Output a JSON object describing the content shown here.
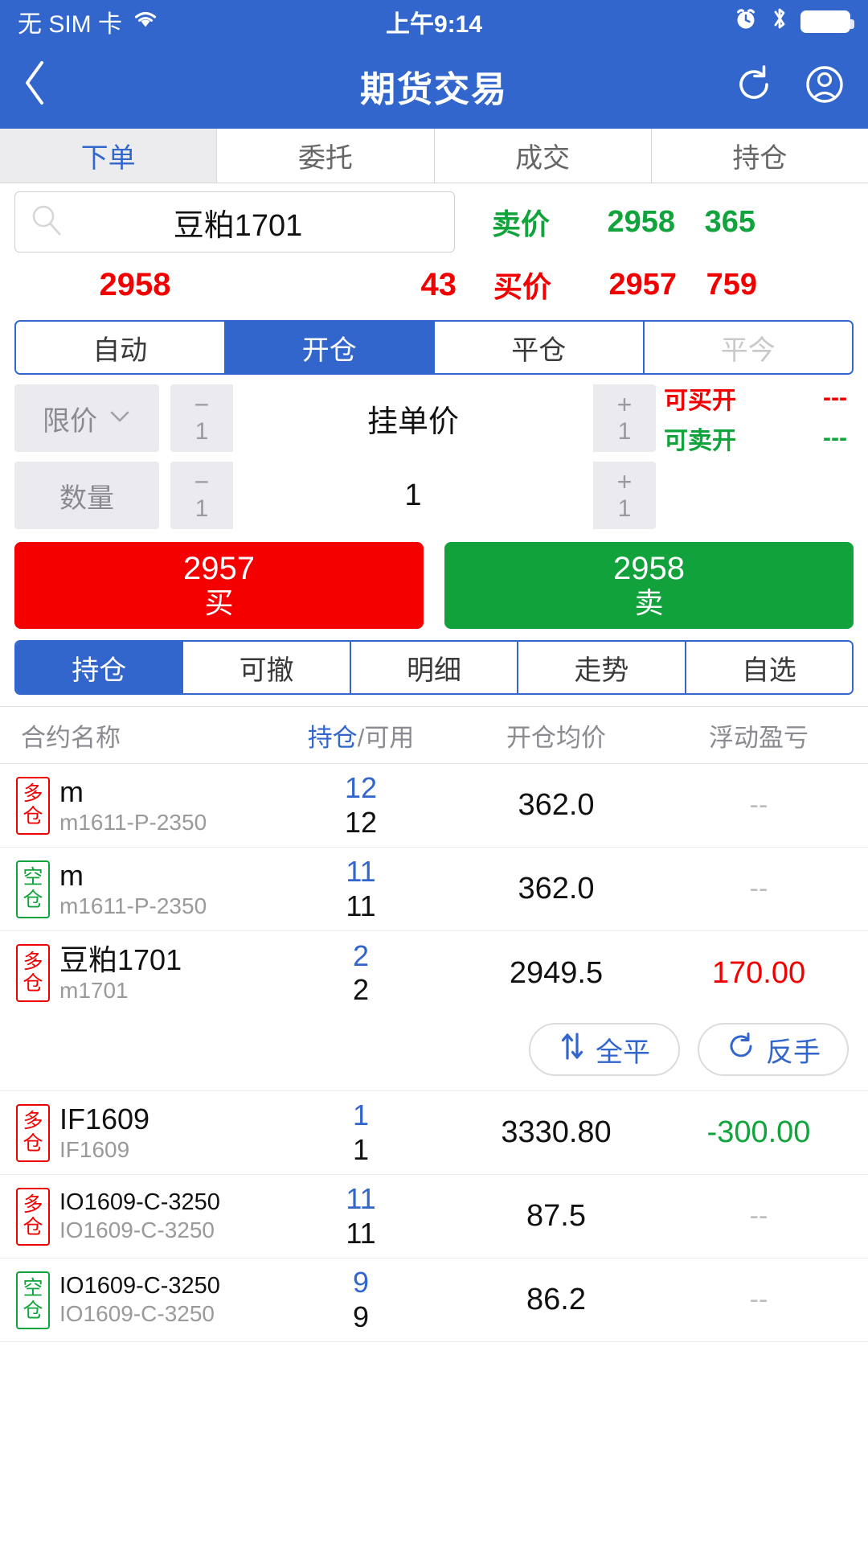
{
  "status_bar": {
    "carrier": "无 SIM 卡",
    "wifi_icon": "wifi-icon",
    "time": "上午9:14",
    "alarm_icon": "alarm-clock-icon",
    "bluetooth_icon": "bluetooth-icon",
    "battery_icon": "battery-icon"
  },
  "navbar": {
    "back_icon": "back-chevron-icon",
    "title": "期货交易",
    "refresh_icon": "refresh-icon",
    "account_icon": "user-account-icon"
  },
  "top_tabs": [
    {
      "label": "下单",
      "active": true
    },
    {
      "label": "委托",
      "active": false
    },
    {
      "label": "成交",
      "active": false
    },
    {
      "label": "持仓",
      "active": false
    }
  ],
  "quote": {
    "search_icon": "search-icon",
    "contract_name": "豆粕1701",
    "search_placeholder": "豆粕1701",
    "ask_label": "卖价",
    "ask_price": "2958",
    "ask_volume": "365",
    "last_price": "2958",
    "last_volume": "43",
    "bid_label": "买价",
    "bid_price": "2957",
    "bid_volume": "759",
    "ask_color": "#11a43c",
    "bid_color": "#f00000"
  },
  "offset_seg": [
    {
      "label": "自动",
      "active": false,
      "disabled": false
    },
    {
      "label": "开仓",
      "active": true,
      "disabled": false
    },
    {
      "label": "平仓",
      "active": false,
      "disabled": false
    },
    {
      "label": "平今",
      "active": false,
      "disabled": true
    }
  ],
  "price_row": {
    "type_label": "限价",
    "caret_icon": "chevron-down-icon",
    "minus_sign": "−",
    "minus_step": "1",
    "plus_sign": "+",
    "plus_step": "1",
    "value": "挂单价",
    "placeholder": "挂单价",
    "buy_open_label": "可买开",
    "buy_open_value": "---",
    "sell_open_label": "可卖开",
    "sell_open_value": "---"
  },
  "qty_row": {
    "label": "数量",
    "minus_sign": "−",
    "minus_step": "1",
    "plus_sign": "+",
    "plus_step": "1",
    "value": "1"
  },
  "trade_buttons": {
    "buy_price": "2957",
    "buy_label": "买",
    "buy_color": "#f40000",
    "sell_price": "2958",
    "sell_label": "卖",
    "sell_color": "#11a23c"
  },
  "bottom_seg": [
    {
      "label": "持仓",
      "active": true
    },
    {
      "label": "可撤",
      "active": false
    },
    {
      "label": "明细",
      "active": false
    },
    {
      "label": "走势",
      "active": false
    },
    {
      "label": "自选",
      "active": false
    }
  ],
  "table": {
    "headers": {
      "name": "合约名称",
      "qty_primary": "持仓",
      "qty_separator": "/",
      "qty_secondary": "可用",
      "avg_price": "开仓均价",
      "pnl": "浮动盈亏"
    },
    "rows": [
      {
        "side_badge": "多仓",
        "side": "long",
        "name": "m",
        "code": "m1611-P-2350",
        "name_small": false,
        "position": "12",
        "available": "12",
        "avg_price": "362.0",
        "pnl": "--",
        "pnl_state": "none",
        "expanded": false
      },
      {
        "side_badge": "空仓",
        "side": "short",
        "name": "m",
        "code": "m1611-P-2350",
        "name_small": false,
        "position": "11",
        "available": "11",
        "avg_price": "362.0",
        "pnl": "--",
        "pnl_state": "none",
        "expanded": false
      },
      {
        "side_badge": "多仓",
        "side": "long",
        "name": "豆粕1701",
        "code": "m1701",
        "name_small": false,
        "position": "2",
        "available": "2",
        "avg_price": "2949.5",
        "pnl": "170.00",
        "pnl_state": "profit",
        "expanded": true
      },
      {
        "side_badge": "多仓",
        "side": "long",
        "name": "IF1609",
        "code": "IF1609",
        "name_small": false,
        "position": "1",
        "available": "1",
        "avg_price": "3330.80",
        "pnl": "-300.00",
        "pnl_state": "loss",
        "expanded": false
      },
      {
        "side_badge": "多仓",
        "side": "long",
        "name": "IO1609-C-3250",
        "code": "IO1609-C-3250",
        "name_small": true,
        "position": "11",
        "available": "11",
        "avg_price": "87.5",
        "pnl": "--",
        "pnl_state": "none",
        "expanded": false
      },
      {
        "side_badge": "空仓",
        "side": "short",
        "name": "IO1609-C-3250",
        "code": "IO1609-C-3250",
        "name_small": true,
        "position": "9",
        "available": "9",
        "avg_price": "86.2",
        "pnl": "--",
        "pnl_state": "none",
        "expanded": false
      }
    ],
    "row_actions": {
      "close_all_icon": "up-down-arrows-icon",
      "close_all_label": "全平",
      "reverse_icon": "refresh-circular-icon",
      "reverse_label": "反手"
    }
  }
}
